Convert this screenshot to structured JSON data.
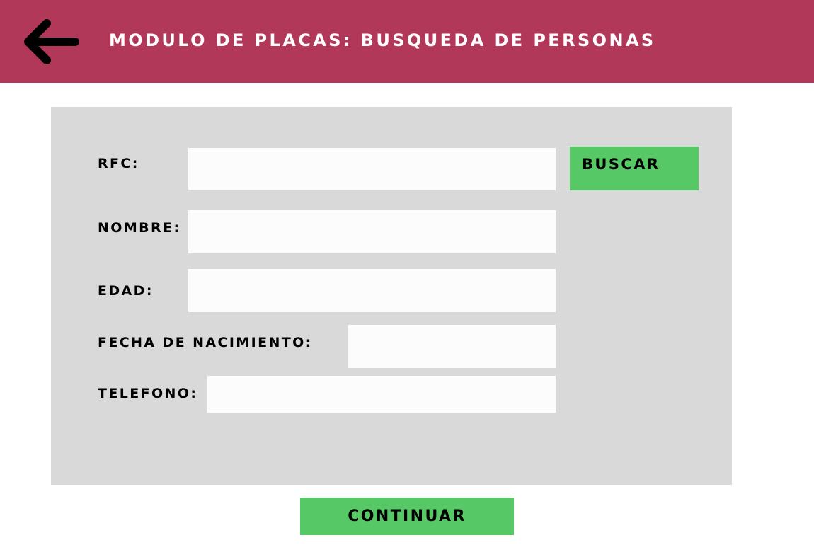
{
  "header": {
    "back_icon": "arrow-left-icon",
    "title": "MODULO DE PLACAS: BUSQUEDA DE PERSONAS",
    "background_color": "#b2385a"
  },
  "form": {
    "rfc": {
      "label": "RFC:",
      "value": "",
      "placeholder": ""
    },
    "nombre": {
      "label": "NOMBRE:",
      "value": "",
      "placeholder": ""
    },
    "edad": {
      "label": "EDAD:",
      "value": "",
      "placeholder": ""
    },
    "fecha_nacimiento": {
      "label": "FECHA DE NACIMIENTO:",
      "value": "",
      "placeholder": ""
    },
    "telefono": {
      "label": "TELEFONO:",
      "value": "",
      "placeholder": ""
    },
    "search_label": "BUSCAR"
  },
  "footer": {
    "continue_label": "CONTINUAR"
  },
  "colors": {
    "accent": "#b2385a",
    "button": "#56c966",
    "panel": "#d9d9d9",
    "field": "#fcfcfc"
  }
}
